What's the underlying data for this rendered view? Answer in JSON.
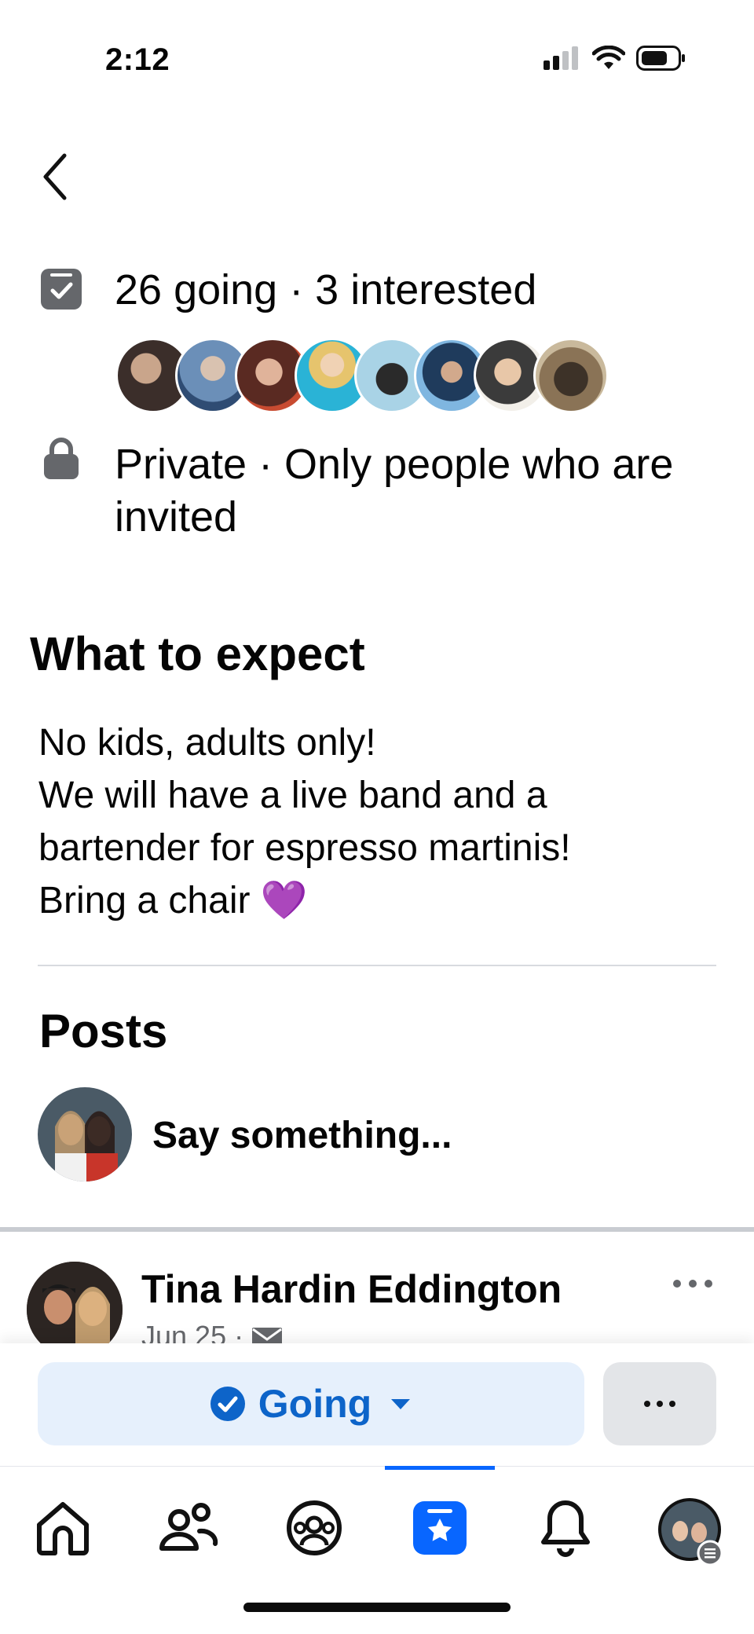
{
  "status_bar": {
    "time": "2:12"
  },
  "event": {
    "attendance_text": "26 going · 3 interested",
    "privacy_text": "Private · Only people who are invited"
  },
  "what_to_expect": {
    "title": "What to expect",
    "body": "No kids, adults only!\nWe will have a live band and a bartender for espresso martinis!\nBring a chair 💜"
  },
  "posts": {
    "title": "Posts",
    "composer_placeholder": "Say something...",
    "items": [
      {
        "author": "Tina Hardin Eddington",
        "date": "Jun 25 ·"
      }
    ]
  },
  "actions": {
    "going_label": "Going"
  },
  "icons": {
    "back": "chevron-left-icon",
    "attendance": "calendar-check-icon",
    "privacy": "lock-icon",
    "more": "more-horizontal-icon",
    "going": "check-circle-icon",
    "dropdown": "caret-down-icon",
    "tabs": [
      "home-icon",
      "friends-icon",
      "groups-icon",
      "events-icon",
      "notifications-icon",
      "profile-avatar"
    ]
  },
  "colors": {
    "accent": "#0866ff",
    "going_bg": "#e6f0fc",
    "going_text": "#0d64c9"
  }
}
